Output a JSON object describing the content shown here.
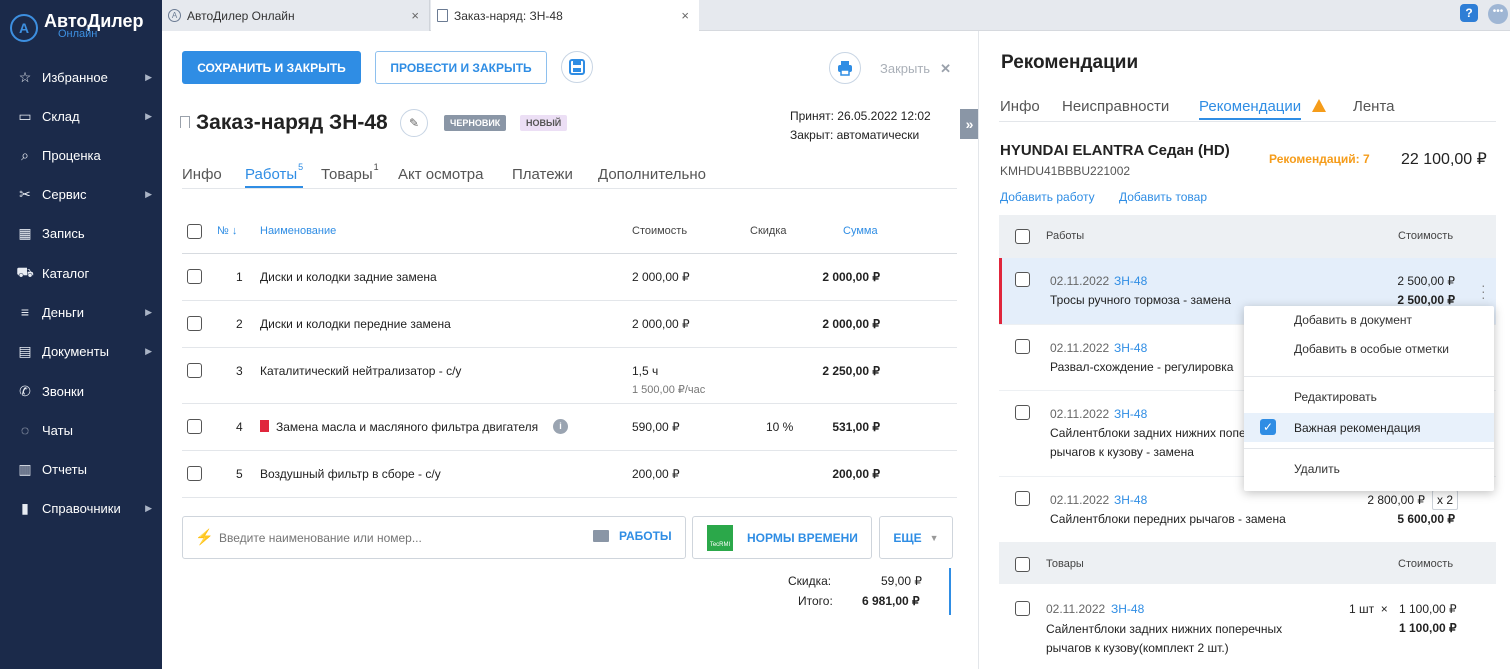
{
  "app": {
    "logo_name": "АвтоДилер",
    "logo_sub": "Онлайн"
  },
  "sidebar": {
    "items": [
      {
        "label": "Избранное",
        "icon": "star-icon",
        "arrow": true
      },
      {
        "label": "Склад",
        "icon": "warehouse-icon",
        "arrow": true
      },
      {
        "label": "Проценка",
        "icon": "magnifier-icon",
        "arrow": false
      },
      {
        "label": "Сервис",
        "icon": "wrench-icon",
        "arrow": true
      },
      {
        "label": "Запись",
        "icon": "calendar-icon",
        "arrow": false
      },
      {
        "label": "Каталог",
        "icon": "car-icon",
        "arrow": false
      },
      {
        "label": "Деньги",
        "icon": "coins-icon",
        "arrow": true
      },
      {
        "label": "Документы",
        "icon": "documents-icon",
        "arrow": true
      },
      {
        "label": "Звонки",
        "icon": "phone-icon",
        "arrow": false
      },
      {
        "label": "Чаты",
        "icon": "chat-icon",
        "arrow": false
      },
      {
        "label": "Отчеты",
        "icon": "chart-icon",
        "arrow": false
      },
      {
        "label": "Справочники",
        "icon": "book-icon",
        "arrow": true
      }
    ]
  },
  "browser_tabs": [
    {
      "label": "АвтоДилер Онлайн",
      "close": "×"
    },
    {
      "label": "Заказ-наряд: ЗН-48",
      "close": "×"
    }
  ],
  "help": "?",
  "order": {
    "save_close": "СОХРАНИТЬ И ЗАКРЫТЬ",
    "post_close": "ПРОВЕСТИ И ЗАКРЫТЬ",
    "close_label": "Закрыть",
    "title": "Заказ-наряд ЗН-48",
    "badge_draft": "ЧЕРНОВИК",
    "badge_new": "НОВЫЙ",
    "accepted": "Принят: 26.05.2022 12:02",
    "closed": "Закрыт: автоматически",
    "tabs": [
      {
        "label": "Инфо",
        "count": ""
      },
      {
        "label": "Работы",
        "count": "5"
      },
      {
        "label": "Товары",
        "count": "1"
      },
      {
        "label": "Акт осмотра",
        "count": ""
      },
      {
        "label": "Платежи",
        "count": ""
      },
      {
        "label": "Дополнительно",
        "count": ""
      }
    ],
    "columns": {
      "num": "№",
      "name": "Наименование",
      "cost": "Стоимость",
      "discount": "Скидка",
      "sum": "Сумма"
    },
    "rows": [
      {
        "n": "1",
        "name": "Диски и колодки задние замена",
        "cost": "2 000,00 ₽",
        "cost2": "",
        "discount": "",
        "sum": "2 000,00 ₽"
      },
      {
        "n": "2",
        "name": "Диски и колодки передние замена",
        "cost": "2 000,00 ₽",
        "cost2": "",
        "discount": "",
        "sum": "2 000,00 ₽"
      },
      {
        "n": "3",
        "name": "Каталитический нейтрализатор - с/у",
        "cost": "1,5 ч",
        "cost2": "1 500,00 ₽/час",
        "discount": "",
        "sum": "2 250,00 ₽"
      },
      {
        "n": "4",
        "name": "Замена масла и масляного фильтра двигателя",
        "cost": "590,00 ₽",
        "cost2": "",
        "discount": "10 %",
        "sum": "531,00 ₽"
      },
      {
        "n": "5",
        "name": "Воздушный фильтр в сборе - с/у",
        "cost": "200,00 ₽",
        "cost2": "",
        "discount": "",
        "sum": "200,00 ₽"
      }
    ],
    "search_placeholder": "Введите наименование или номер...",
    "btn_works": "РАБОТЫ",
    "btn_norms": "НОРМЫ ВРЕМЕНИ",
    "btn_more": "ЕЩЕ",
    "tecrmi": "TecRMI",
    "discount_label": "Скидка:",
    "discount_value": "59,00 ₽",
    "total_label": "Итого:",
    "total_value": "6 981,00 ₽"
  },
  "panel": {
    "title": "Рекомендации",
    "tabs": [
      "Инфо",
      "Неисправности",
      "Рекомендации",
      "Лента"
    ],
    "car": "HYUNDAI ELANTRA Седан (HD)",
    "vin": "KMHDU41BBBU221002",
    "rec_count": "Рекомендаций: 7",
    "rec_sum": "22 100,00 ₽",
    "add_work": "Добавить работу",
    "add_goods": "Добавить товар",
    "works_header": "Работы",
    "cost_header": "Стоимость",
    "goods_header": "Товары",
    "items": [
      {
        "date": "02.11.2022",
        "doc": "ЗН-48",
        "name": "Тросы ручного тормоза - замена",
        "name2": "",
        "price": "2 500,00 ₽",
        "total": "2 500,00 ₽",
        "qty": ""
      },
      {
        "date": "02.11.2022",
        "doc": "ЗН-48",
        "name": "Развал-схождение - регулировка",
        "name2": "",
        "price": "",
        "total": "",
        "qty": ""
      },
      {
        "date": "02.11.2022",
        "doc": "ЗН-48",
        "name": "Сайлентблоки задних нижних попе",
        "name2": "рычагов к кузову - замена",
        "price": "",
        "total": "",
        "qty": ""
      },
      {
        "date": "02.11.2022",
        "doc": "ЗН-48",
        "name": "Сайлентблоки передних рычагов - замена",
        "name2": "",
        "price": "2 800,00 ₽",
        "total": "5 600,00 ₽",
        "qty": "x 2"
      }
    ],
    "goods": [
      {
        "date": "02.11.2022",
        "doc": "ЗН-48",
        "name": "Сайлентблоки задних нижних поперечных",
        "name2": "рычагов к кузову(комплект 2 шт.)",
        "qty": "1 шт  ×",
        "price": "1 100,00 ₽",
        "total": "1 100,00 ₽"
      }
    ],
    "menu": [
      "Добавить в документ",
      "Добавить в особые отметки",
      "Редактировать",
      "Важная рекомендация",
      "Удалить"
    ]
  },
  "colors": {
    "sidebar": "#1b2a4a",
    "accent": "#2f8de4",
    "warn": "#f59c1a",
    "red": "#e0263c"
  }
}
